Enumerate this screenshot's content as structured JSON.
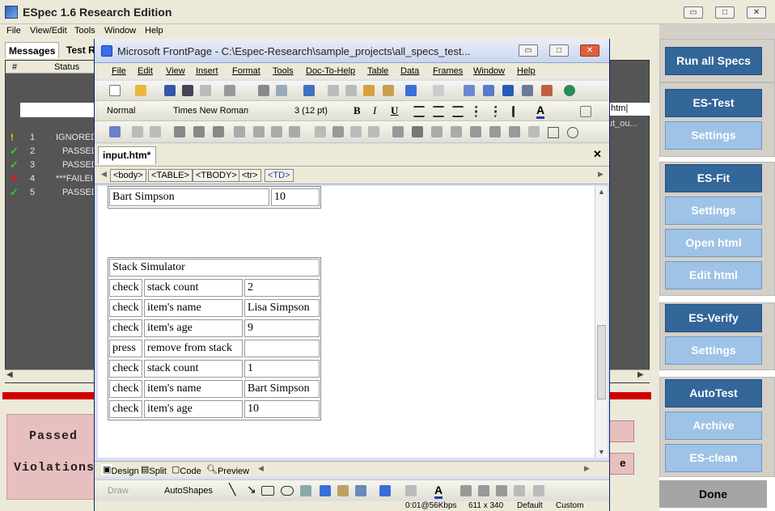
{
  "main_window": {
    "title": "ESpec 1.6 Research Edition",
    "menu": [
      "File",
      "View/Edit",
      "Tools",
      "Window",
      "Help"
    ],
    "controls": {
      "minimize": "▭",
      "restore": "□",
      "close": "✕"
    }
  },
  "left_panel": {
    "tabs": [
      "Messages",
      "Test R"
    ],
    "grid_headers": [
      "#",
      "Status"
    ],
    "rows": [
      {
        "num": "1",
        "status": "IGNORED",
        "icon": "warning-icon",
        "icon_color": "#f2c200"
      },
      {
        "num": "2",
        "status": "PASSED",
        "icon": "check-icon",
        "icon_color": "#33cc33"
      },
      {
        "num": "3",
        "status": "PASSED",
        "icon": "check-icon",
        "icon_color": "#33cc33"
      },
      {
        "num": "4",
        "status": "***FAILEI",
        "icon": "cross-icon",
        "icon_color": "#e02020"
      },
      {
        "num": "5",
        "status": "PASSED",
        "icon": "check-icon",
        "icon_color": "#33cc33"
      }
    ],
    "behind_text_1": "t.htm|",
    "behind_text_2": "ut_ou...",
    "status_box": {
      "passed": "Passed",
      "violations": "Violations"
    },
    "hidden_button_text": "e"
  },
  "sidebar": {
    "run_all": "Run all Specs",
    "es_test": "ES-Test",
    "es_test_settings": "Settings",
    "es_fit": "ES-Fit",
    "es_fit_settings": "Settings",
    "open_html": "Open html",
    "edit_html": "Edit html",
    "es_verify": "ES-Verify",
    "es_verify_settings": "Settings",
    "autotest": "AutoTest",
    "archive": "Archive",
    "es_clean": "ES-clean",
    "done": "Done"
  },
  "frontpage": {
    "title": "Microsoft FrontPage - C:\\Espec-Research\\sample_projects\\all_specs_test...",
    "menu": [
      "File",
      "Edit",
      "View",
      "Insert",
      "Format",
      "Tools",
      "Doc-To-Help",
      "Table",
      "Data",
      "Frames",
      "Window",
      "Help"
    ],
    "style_select": "Normal",
    "font_select": "Times New Roman",
    "size_select": "3  (12 pt)",
    "doc_tab": "input.htm*",
    "quick_tags": [
      "<body>",
      "<TABLE>",
      "<TBODY>",
      "<tr>",
      "<TD>"
    ],
    "view_tabs": [
      "Design",
      "Split",
      "Code",
      "Preview"
    ],
    "drawing": {
      "draw": "Draw",
      "autoshapes": "AutoShapes"
    },
    "status": {
      "speed": "0:01@56Kbps",
      "size": "611 x 340",
      "default": "Default",
      "custom": "Custom"
    }
  },
  "document": {
    "top_row": [
      "Bart Simpson",
      "10"
    ],
    "table_title": "Stack Simulator",
    "rows": [
      [
        "check",
        "stack count",
        "2"
      ],
      [
        "check",
        "item's name",
        "Lisa Simpson"
      ],
      [
        "check",
        "item's age",
        "9"
      ],
      [
        "press",
        "remove from stack",
        ""
      ],
      [
        "check",
        "stack count",
        "1"
      ],
      [
        "check",
        "item's name",
        "Bart Simpson"
      ],
      [
        "check",
        "item's age",
        "10"
      ]
    ]
  }
}
